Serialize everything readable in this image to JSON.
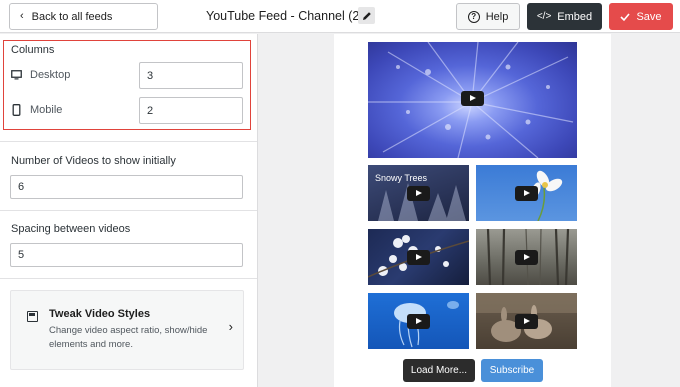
{
  "header": {
    "back_label": "Back to all feeds",
    "title": "YouTube Feed - Channel (2)",
    "help_label": "Help",
    "embed_label": "Embed",
    "save_label": "Save",
    "icons": {
      "back": "chevron-left-icon",
      "edit": "pencil-icon",
      "help": "question-circle-icon",
      "embed": "code-icon",
      "save": "checkmark-icon"
    }
  },
  "sidebar": {
    "columns": {
      "heading": "Columns",
      "desktop": {
        "label": "Desktop",
        "value": "3",
        "icon": "desktop-icon"
      },
      "mobile": {
        "label": "Mobile",
        "value": "2",
        "icon": "mobile-icon"
      }
    },
    "num_videos": {
      "label": "Number of Videos to show initially",
      "value": "6"
    },
    "spacing": {
      "label": "Spacing between videos",
      "value": "5"
    },
    "tweak": {
      "title": "Tweak Video Styles",
      "description": "Change video aspect ratio, show/hide elements and more.",
      "icon": "layout-icon"
    }
  },
  "preview": {
    "videos": [
      {
        "title": "",
        "subject": "blue snowy forest aerial"
      },
      {
        "title": "Snowy Trees",
        "subject": "snowy trees"
      },
      {
        "title": "",
        "subject": "white flower blue sky"
      },
      {
        "title": "",
        "subject": "white blossoms"
      },
      {
        "title": "",
        "subject": "misty forest"
      },
      {
        "title": "",
        "subject": "jellyfish"
      },
      {
        "title": "",
        "subject": "rabbits"
      }
    ],
    "load_more_label": "Load More...",
    "subscribe_label": "Subscribe"
  },
  "colors": {
    "save": "#e54b4b",
    "embed": "#2c3338",
    "highlight_border": "#e0433b",
    "subscribe": "#4a90d9",
    "load_more": "#2c2c2c"
  }
}
